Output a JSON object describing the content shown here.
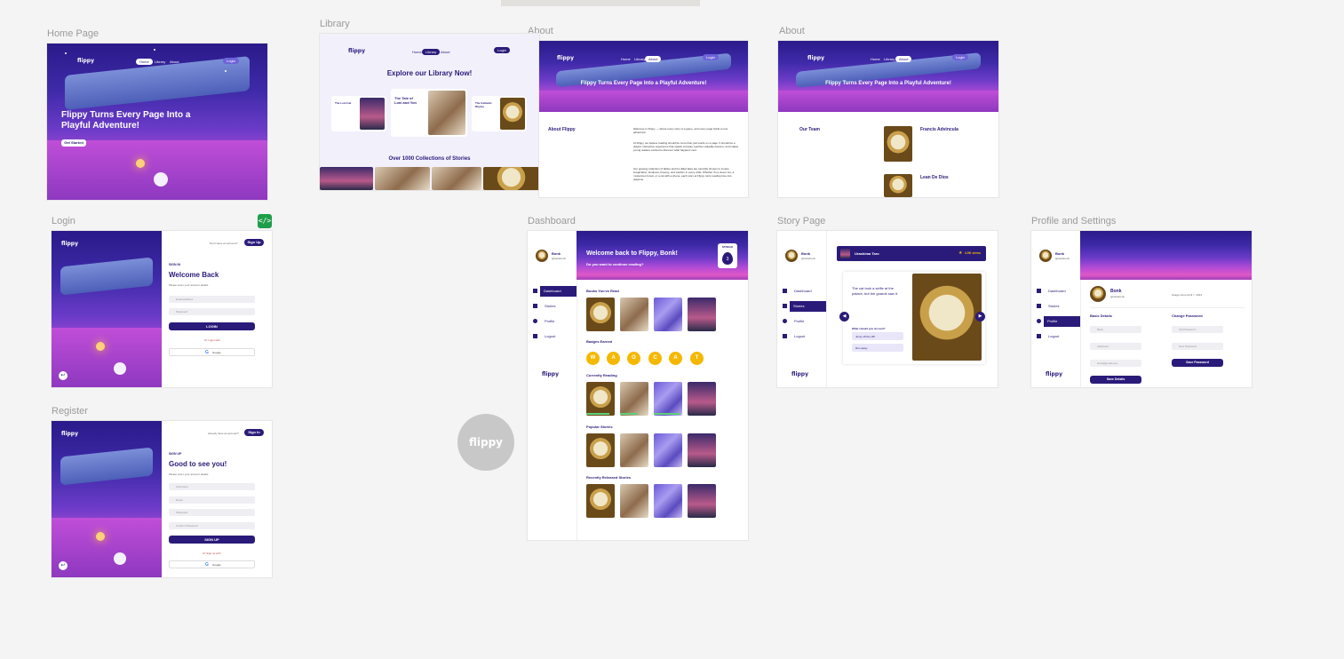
{
  "frames": {
    "home": "Home Page",
    "library": "Library",
    "about1": "About",
    "about2": "About",
    "login": "Login",
    "dashboard": "Dashboard",
    "story": "Story Page",
    "profile": "Profile and Settings",
    "register": "Register"
  },
  "brand": "flippy",
  "nav": {
    "home": "Home",
    "library": "Library",
    "about": "About",
    "login": "Login"
  },
  "home": {
    "hero": "Flippy Turns Every Page Into a Playful Adventure!",
    "cta": "Get Started"
  },
  "library": {
    "title": "Explore our Library Now!",
    "book_title": "The Tale of Loni and Yon",
    "left_card": "The Lost Isle",
    "right_card": "The Cattastic Rhyme",
    "subtitle": "Over 1000 Collections of Stories"
  },
  "about": {
    "hero": "Flippy Turns Every Page Into a Playful Adventure!",
    "section": "About Flippy",
    "para1": "Welcome to Flippy — where every story is a game, and every page holds a new adventure!",
    "para2": "At Flippy, we believe reading should be more than just words on a page. It should be a playful, interactive experience that sparks curiosity, teaches valuable lessons, and makes young readers excited to discover what happens next.",
    "para3": "Our growing collection of fables and fun-filled tales are carefully chosen to inspire imagination, kindness, bravery, and wisdom in every child. Whether it's a clever fox, a mysterious forest, or a cat with a phone, each story at Flippy turns reading time into playtime."
  },
  "team": {
    "section": "Our Team",
    "member1": "Francis Advincula",
    "member2": "Lean De Dios"
  },
  "login": {
    "signin": "SIGN IN",
    "welcome": "Welcome Back",
    "sub": "Please enter your account details",
    "email": "Email Address",
    "password": "Password",
    "button": "LOGIN",
    "or": "Or Login with",
    "google": "Google",
    "top_prompt": "Don't have an account?",
    "top_button": "Sign Up"
  },
  "register": {
    "signup": "SIGN UP",
    "welcome": "Good to see you!",
    "sub": "Please enter your account details",
    "username": "Username",
    "email": "Email",
    "password": "Password",
    "confirm": "Confirm Password",
    "button": "SIGN UP",
    "or": "Or Sign up with",
    "google": "Google",
    "top_prompt": "Already have an account?",
    "top_button": "Sign In"
  },
  "dashboard": {
    "user": "Bonk",
    "handle": "@catiebonk",
    "welcome": "Welcome back to Flippy, Bonk!",
    "sub": "Do you want to continue reading?",
    "streak": "STREAK",
    "streak_count": "3",
    "nav": [
      "Dashboard",
      "Stories",
      "Profile",
      "Logout"
    ],
    "books_read": "Books You've Read",
    "badges": "Badges Earned",
    "badge_letters": [
      "W",
      "A",
      "O",
      "C",
      "A",
      "T"
    ],
    "current": "Currently Reading",
    "popular": "Popular Stories",
    "recent": "Recently Released Stories"
  },
  "story": {
    "user": "Bonk",
    "handle": "@catiebonk",
    "title": "Urashima Taro",
    "views": "4.9K views",
    "text": "The cat took a selfie at the palace, but the guards saw it.",
    "question": "What should you do next?",
    "choice1": "Jump off the cliff",
    "choice2": "Run away",
    "nav": [
      "Dashboard",
      "Stories",
      "Profile",
      "Logout"
    ]
  },
  "profile": {
    "user": "Bonk",
    "handle": "@catiebonk",
    "since": "Usage since April 7, 2024",
    "basic": "Basic Details",
    "change_pw": "Change Password",
    "fields_left": [
      "Bonk",
      "catiebonk",
      "bonk@gmail.com"
    ],
    "fields_right": [
      "Old Password",
      "New Password"
    ],
    "save": "Save Details",
    "save_pw": "Save Password",
    "nav": [
      "Dashboard",
      "Stories",
      "Profile",
      "Logout"
    ]
  },
  "floating_logo": "flippy"
}
